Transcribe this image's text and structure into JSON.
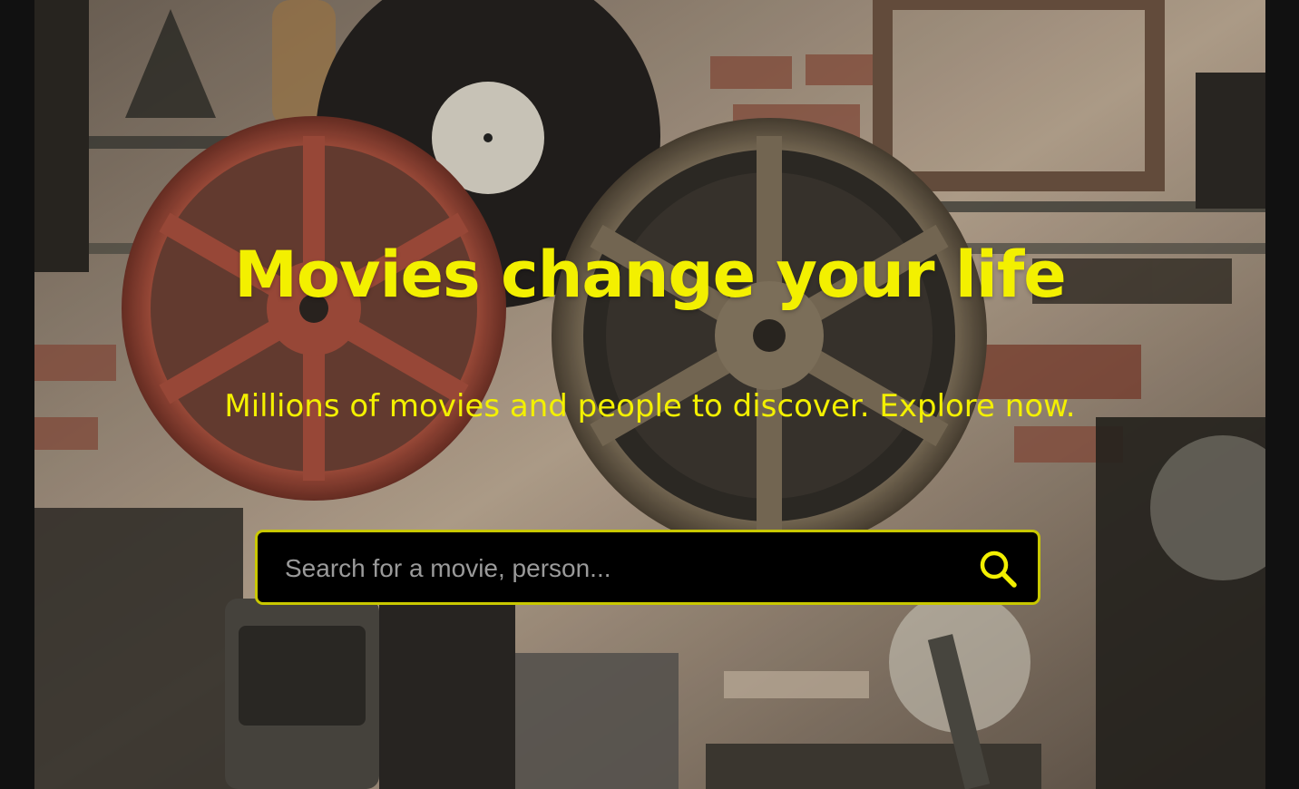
{
  "hero": {
    "title": "Movies change your life",
    "subtitle": "Millions of movies and people to discover. Explore now."
  },
  "search": {
    "placeholder": "Search for a movie, person...",
    "value": "",
    "icon": "search-icon"
  },
  "colors": {
    "accent": "#f3f000",
    "search_border": "#c9c800",
    "search_background": "#000000",
    "page_background": "#111111"
  }
}
